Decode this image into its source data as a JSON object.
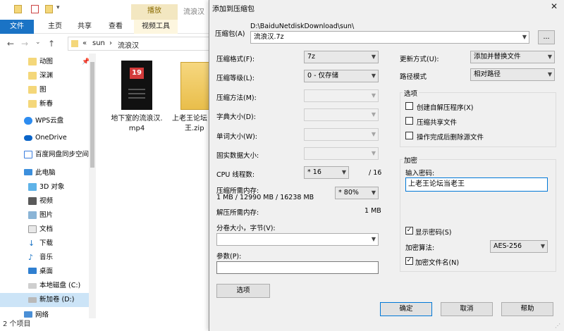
{
  "explorer": {
    "title": "流浪汉",
    "context_tab_header": "播放",
    "tabs": [
      "文件",
      "主页",
      "共享",
      "查看",
      "视频工具"
    ],
    "address": [
      "«",
      "sun",
      "›",
      "流浪汉"
    ],
    "nav_items": [
      {
        "label": "动图",
        "icon": "folder-icon"
      },
      {
        "label": "深渊",
        "icon": "folder-icon"
      },
      {
        "label": "图",
        "icon": "folder-icon"
      },
      {
        "label": "新春",
        "icon": "folder-icon"
      },
      {
        "label": "WPS云盘",
        "icon": "cloud-icon"
      },
      {
        "label": "OneDrive",
        "icon": "onedrive-icon"
      },
      {
        "label": "百度网盘同步空间",
        "icon": "baidu-icon"
      },
      {
        "label": "此电脑",
        "icon": "computer-icon"
      },
      {
        "label": "3D 对象",
        "icon": "cube-icon"
      },
      {
        "label": "视频",
        "icon": "video-icon"
      },
      {
        "label": "图片",
        "icon": "picture-icon"
      },
      {
        "label": "文档",
        "icon": "document-icon"
      },
      {
        "label": "下载",
        "icon": "download-icon"
      },
      {
        "label": "音乐",
        "icon": "music-icon"
      },
      {
        "label": "桌面",
        "icon": "desktop-icon"
      },
      {
        "label": "本地磁盘 (C:)",
        "icon": "drive-icon"
      },
      {
        "label": "新加卷 (D:)",
        "icon": "drive-icon"
      },
      {
        "label": "网络",
        "icon": "network-icon"
      }
    ],
    "files": [
      {
        "name_line1": "地下室的流浪汉.",
        "name_line2": "mp4",
        "badge": "19"
      },
      {
        "name_line1": "上老王论坛",
        "name_line2": "王.zip"
      }
    ],
    "status": "2 个项目"
  },
  "dialog": {
    "title": "添加到压缩包",
    "close": "✕",
    "archive_label": "压缩包(A)",
    "archive_dir": "D:\\BaiduNetdiskDownload\\sun\\",
    "archive_name": "流浪汉.7z",
    "browse_label": "...",
    "format_label": "压缩格式(F):",
    "format_value": "7z",
    "level_label": "压缩等级(L):",
    "level_value": "0 - 仅存储",
    "method_label": "压缩方法(M):",
    "dict_label": "字典大小(D):",
    "word_label": "单词大小(W):",
    "solid_label": "固实数据大小:",
    "cpu_label": "CPU 线程数:",
    "cpu_value": "* 16",
    "cpu_total": "/ 16",
    "mem_label": "压缩所需内存:",
    "mem_detail": "1 MB / 12990 MB / 16238 MB",
    "mem_percent": "* 80%",
    "decomp_label": "解压所需内存:",
    "decomp_value": "1 MB",
    "split_label": "分卷大小，字节(V):",
    "params_label": "参数(P):",
    "options_button": "选项",
    "update_label": "更新方式(U):",
    "update_value": "添加并替换文件",
    "pathmode_label": "路径模式",
    "pathmode_value": "相对路径",
    "options_group": "选项",
    "opt_sfx": "创建自解压程序(X)",
    "opt_shared": "压缩共享文件",
    "opt_delete": "操作完成后删除源文件",
    "encryption_group": "加密",
    "password_label": "输入密码:",
    "password_value": "上老王论坛当老王",
    "show_password": "显示密码(S)",
    "show_password_checked": "✓",
    "algo_label": "加密算法:",
    "algo_value": "AES-256",
    "encrypt_names": "加密文件名(N)",
    "encrypt_names_checked": "✓",
    "ok": "确定",
    "cancel": "取消",
    "help": "帮助"
  }
}
